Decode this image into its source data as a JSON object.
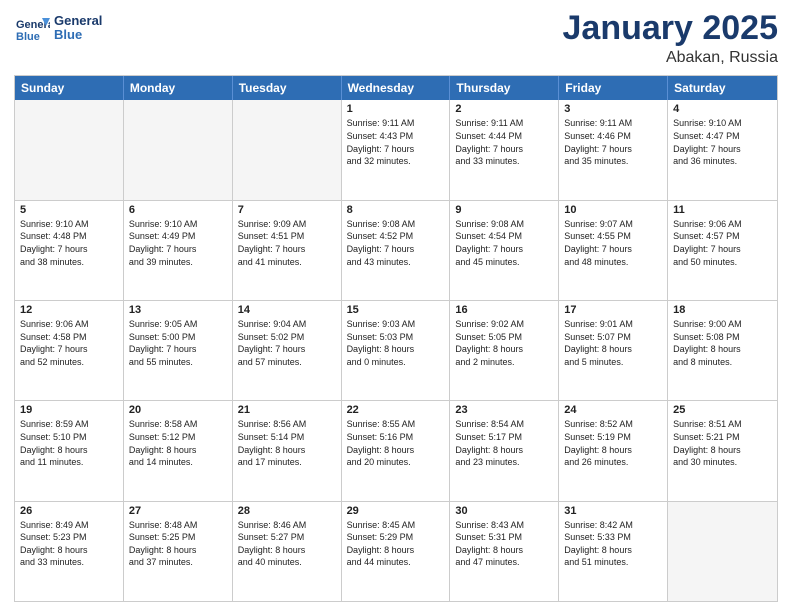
{
  "header": {
    "logo_line1": "General",
    "logo_line2": "Blue",
    "month_year": "January 2025",
    "location": "Abakan, Russia"
  },
  "days_of_week": [
    "Sunday",
    "Monday",
    "Tuesday",
    "Wednesday",
    "Thursday",
    "Friday",
    "Saturday"
  ],
  "weeks": [
    [
      {
        "day": "",
        "content": "",
        "empty": true
      },
      {
        "day": "",
        "content": "",
        "empty": true
      },
      {
        "day": "",
        "content": "",
        "empty": true
      },
      {
        "day": "1",
        "content": "Sunrise: 9:11 AM\nSunset: 4:43 PM\nDaylight: 7 hours\nand 32 minutes.",
        "empty": false
      },
      {
        "day": "2",
        "content": "Sunrise: 9:11 AM\nSunset: 4:44 PM\nDaylight: 7 hours\nand 33 minutes.",
        "empty": false
      },
      {
        "day": "3",
        "content": "Sunrise: 9:11 AM\nSunset: 4:46 PM\nDaylight: 7 hours\nand 35 minutes.",
        "empty": false
      },
      {
        "day": "4",
        "content": "Sunrise: 9:10 AM\nSunset: 4:47 PM\nDaylight: 7 hours\nand 36 minutes.",
        "empty": false
      }
    ],
    [
      {
        "day": "5",
        "content": "Sunrise: 9:10 AM\nSunset: 4:48 PM\nDaylight: 7 hours\nand 38 minutes.",
        "empty": false
      },
      {
        "day": "6",
        "content": "Sunrise: 9:10 AM\nSunset: 4:49 PM\nDaylight: 7 hours\nand 39 minutes.",
        "empty": false
      },
      {
        "day": "7",
        "content": "Sunrise: 9:09 AM\nSunset: 4:51 PM\nDaylight: 7 hours\nand 41 minutes.",
        "empty": false
      },
      {
        "day": "8",
        "content": "Sunrise: 9:08 AM\nSunset: 4:52 PM\nDaylight: 7 hours\nand 43 minutes.",
        "empty": false
      },
      {
        "day": "9",
        "content": "Sunrise: 9:08 AM\nSunset: 4:54 PM\nDaylight: 7 hours\nand 45 minutes.",
        "empty": false
      },
      {
        "day": "10",
        "content": "Sunrise: 9:07 AM\nSunset: 4:55 PM\nDaylight: 7 hours\nand 48 minutes.",
        "empty": false
      },
      {
        "day": "11",
        "content": "Sunrise: 9:06 AM\nSunset: 4:57 PM\nDaylight: 7 hours\nand 50 minutes.",
        "empty": false
      }
    ],
    [
      {
        "day": "12",
        "content": "Sunrise: 9:06 AM\nSunset: 4:58 PM\nDaylight: 7 hours\nand 52 minutes.",
        "empty": false
      },
      {
        "day": "13",
        "content": "Sunrise: 9:05 AM\nSunset: 5:00 PM\nDaylight: 7 hours\nand 55 minutes.",
        "empty": false
      },
      {
        "day": "14",
        "content": "Sunrise: 9:04 AM\nSunset: 5:02 PM\nDaylight: 7 hours\nand 57 minutes.",
        "empty": false
      },
      {
        "day": "15",
        "content": "Sunrise: 9:03 AM\nSunset: 5:03 PM\nDaylight: 8 hours\nand 0 minutes.",
        "empty": false
      },
      {
        "day": "16",
        "content": "Sunrise: 9:02 AM\nSunset: 5:05 PM\nDaylight: 8 hours\nand 2 minutes.",
        "empty": false
      },
      {
        "day": "17",
        "content": "Sunrise: 9:01 AM\nSunset: 5:07 PM\nDaylight: 8 hours\nand 5 minutes.",
        "empty": false
      },
      {
        "day": "18",
        "content": "Sunrise: 9:00 AM\nSunset: 5:08 PM\nDaylight: 8 hours\nand 8 minutes.",
        "empty": false
      }
    ],
    [
      {
        "day": "19",
        "content": "Sunrise: 8:59 AM\nSunset: 5:10 PM\nDaylight: 8 hours\nand 11 minutes.",
        "empty": false
      },
      {
        "day": "20",
        "content": "Sunrise: 8:58 AM\nSunset: 5:12 PM\nDaylight: 8 hours\nand 14 minutes.",
        "empty": false
      },
      {
        "day": "21",
        "content": "Sunrise: 8:56 AM\nSunset: 5:14 PM\nDaylight: 8 hours\nand 17 minutes.",
        "empty": false
      },
      {
        "day": "22",
        "content": "Sunrise: 8:55 AM\nSunset: 5:16 PM\nDaylight: 8 hours\nand 20 minutes.",
        "empty": false
      },
      {
        "day": "23",
        "content": "Sunrise: 8:54 AM\nSunset: 5:17 PM\nDaylight: 8 hours\nand 23 minutes.",
        "empty": false
      },
      {
        "day": "24",
        "content": "Sunrise: 8:52 AM\nSunset: 5:19 PM\nDaylight: 8 hours\nand 26 minutes.",
        "empty": false
      },
      {
        "day": "25",
        "content": "Sunrise: 8:51 AM\nSunset: 5:21 PM\nDaylight: 8 hours\nand 30 minutes.",
        "empty": false
      }
    ],
    [
      {
        "day": "26",
        "content": "Sunrise: 8:49 AM\nSunset: 5:23 PM\nDaylight: 8 hours\nand 33 minutes.",
        "empty": false
      },
      {
        "day": "27",
        "content": "Sunrise: 8:48 AM\nSunset: 5:25 PM\nDaylight: 8 hours\nand 37 minutes.",
        "empty": false
      },
      {
        "day": "28",
        "content": "Sunrise: 8:46 AM\nSunset: 5:27 PM\nDaylight: 8 hours\nand 40 minutes.",
        "empty": false
      },
      {
        "day": "29",
        "content": "Sunrise: 8:45 AM\nSunset: 5:29 PM\nDaylight: 8 hours\nand 44 minutes.",
        "empty": false
      },
      {
        "day": "30",
        "content": "Sunrise: 8:43 AM\nSunset: 5:31 PM\nDaylight: 8 hours\nand 47 minutes.",
        "empty": false
      },
      {
        "day": "31",
        "content": "Sunrise: 8:42 AM\nSunset: 5:33 PM\nDaylight: 8 hours\nand 51 minutes.",
        "empty": false
      },
      {
        "day": "",
        "content": "",
        "empty": true
      }
    ]
  ]
}
